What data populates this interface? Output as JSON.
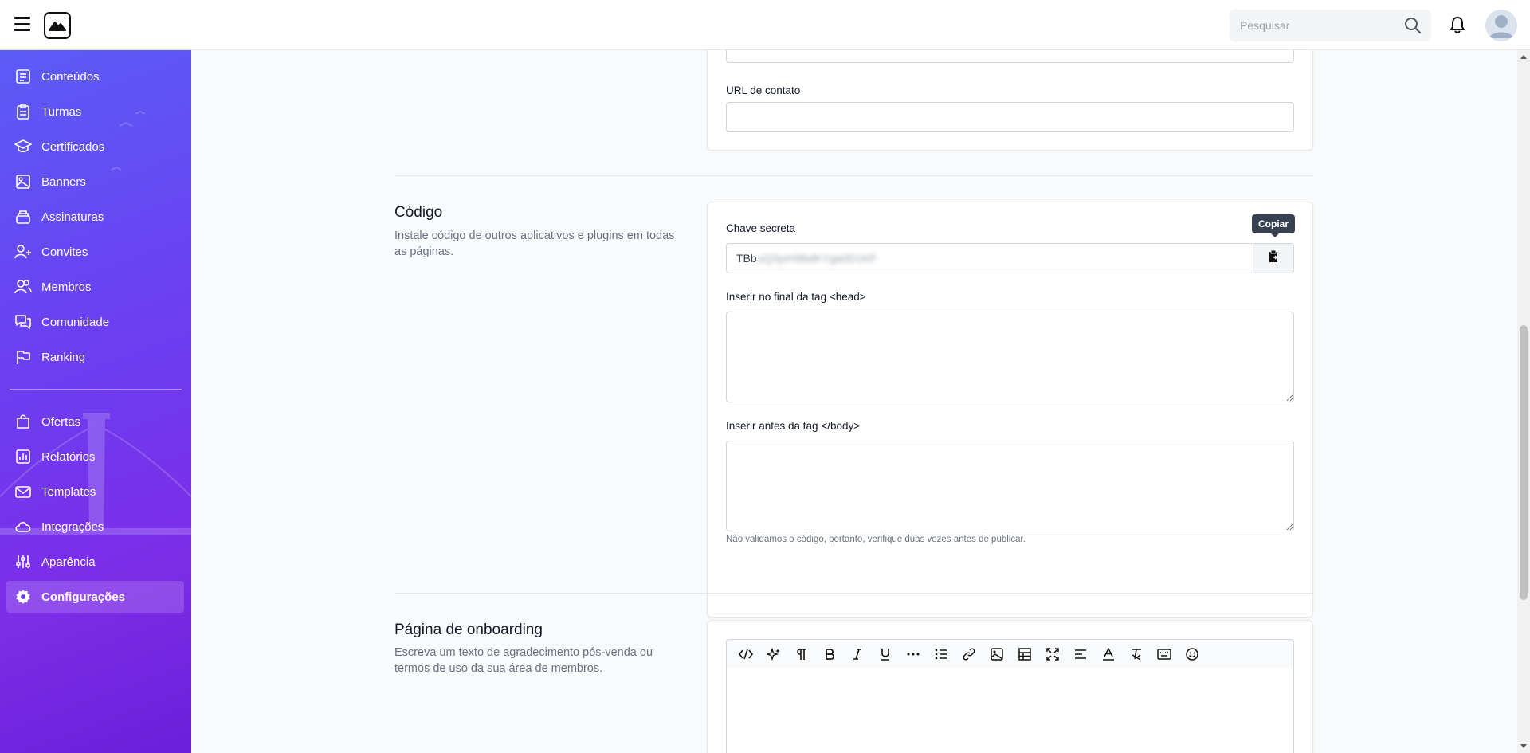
{
  "header": {
    "search_placeholder": "Pesquisar"
  },
  "sidebar": {
    "items": [
      {
        "label": "Conteúdos",
        "icon": "content-icon"
      },
      {
        "label": "Turmas",
        "icon": "clipboard-icon"
      },
      {
        "label": "Certificados",
        "icon": "graduation-cap-icon"
      },
      {
        "label": "Banners",
        "icon": "image-icon"
      },
      {
        "label": "Assinaturas",
        "icon": "subscription-icon"
      },
      {
        "label": "Convites",
        "icon": "user-plus-icon"
      },
      {
        "label": "Membros",
        "icon": "users-icon"
      },
      {
        "label": "Comunidade",
        "icon": "chat-icon"
      },
      {
        "label": "Ranking",
        "icon": "flag-icon"
      },
      {
        "label": "Ofertas",
        "icon": "shopping-bag-icon"
      },
      {
        "label": "Relatórios",
        "icon": "bar-chart-icon"
      },
      {
        "label": "Templates",
        "icon": "mail-icon"
      },
      {
        "label": "Integrações",
        "icon": "cloud-icon"
      },
      {
        "label": "Aparência",
        "icon": "sliders-icon"
      },
      {
        "label": "Configurações",
        "icon": "gear-icon",
        "active": true
      }
    ]
  },
  "contact": {
    "url_label": "URL de contato",
    "url_value": ""
  },
  "code_section": {
    "title": "Código",
    "description": "Instale código de outros aplicativos e plugins em todas as páginas.",
    "secret_label": "Chave secreta",
    "secret_prefix": "TBb",
    "secret_hidden": "uQ3yrH9bdKYga0D1KF",
    "copy_tooltip": "Copiar",
    "head_label": "Inserir no final da tag <head>",
    "head_value": "",
    "body_label": "Inserir antes da tag </body>",
    "body_value": "",
    "help_text": "Não validamos o código, portanto, verifique duas vezes antes de publicar."
  },
  "onboarding_section": {
    "title": "Página de onboarding",
    "description": "Escreva um texto de agradecimento pós-venda ou termos de uso da sua área de membros.",
    "toolbar": [
      "code-view-icon",
      "ai-sparkle-icon",
      "paragraph-icon",
      "bold-icon",
      "italic-icon",
      "underline-icon",
      "more-icon",
      "bullet-list-icon",
      "link-icon",
      "insert-image-icon",
      "table-icon",
      "fullscreen-icon",
      "align-icon",
      "font-color-icon",
      "clear-format-icon",
      "keyboard-icon",
      "emoji-icon"
    ]
  },
  "colors": {
    "sidebar_gradient_start": "#5b5cf6",
    "sidebar_gradient_end": "#6a1fd8",
    "tooltip_bg": "#374151"
  }
}
